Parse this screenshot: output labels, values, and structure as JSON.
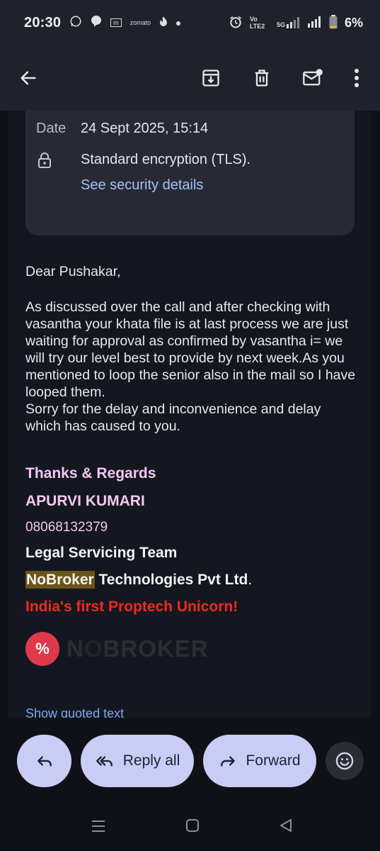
{
  "status_bar": {
    "time": "20:30",
    "left_icons": [
      "whatsapp-icon",
      "chat-icon",
      "m-icon",
      "zomato-icon",
      "fire-icon",
      "dot-icon"
    ],
    "zomato_label": "zomato",
    "m_label": "m",
    "network": "Vo LTE2",
    "fiveg": "5G",
    "battery": "6%"
  },
  "app_bar": {
    "icons": [
      "back-arrow-icon",
      "archive-icon",
      "delete-icon",
      "mark-unread-icon",
      "more-vert-icon"
    ]
  },
  "details": {
    "date_label": "Date",
    "date_value": "24 Sept 2025, 15:14",
    "encryption": "Standard encryption (TLS).",
    "security_link": "See security details"
  },
  "message": {
    "greeting": "Dear Pushakar,",
    "body": "As discussed over the call and after checking with vasantha your khata file is at last process we are just waiting for approval as confirmed by vasantha i= we will try our level best to provide by next week.As you mentioned to loop the senior also in the mail so I have looped them.",
    "body2": "Sorry for the delay and inconvenience  and delay which has caused to  you."
  },
  "signature": {
    "thanks": "Thanks & Regards",
    "name": "APURVI KUMARI",
    "phone": "08068132379",
    "team": "Legal Servicing Team",
    "company_highlight": "NoBroker",
    "company_rest": " Technologies Pvt Ltd",
    "company_dot": ".",
    "tagline": "India's first Proptech Unicorn!",
    "logo_text_o": "O",
    "logo_text_n": "N",
    "logo_text_rest": "BROKER",
    "logo_mark": "%"
  },
  "quoted": "Show quoted text",
  "actions": {
    "reply_all": "Reply all",
    "forward": "Forward"
  },
  "colors": {
    "accent": "#c9cdf6",
    "link": "#a6c1f5",
    "signature_pink": "#f6c6f2",
    "tagline_red": "#f2291e",
    "highlight": "#6b5415"
  }
}
